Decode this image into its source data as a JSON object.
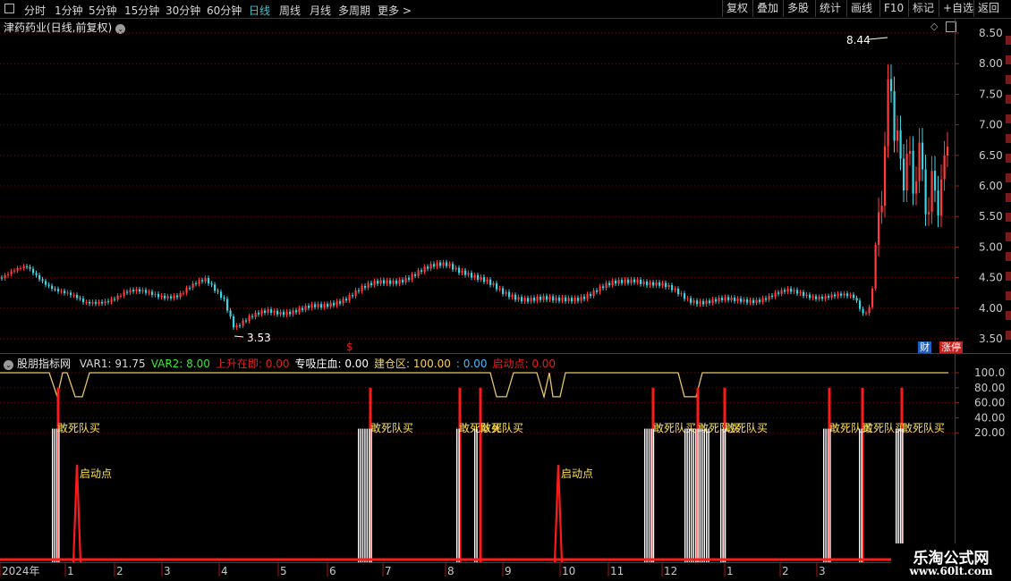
{
  "toolbar": {
    "periods": [
      "分时",
      "1分钟",
      "5分钟",
      "15分钟",
      "30分钟",
      "60分钟",
      "日线",
      "周线",
      "月线",
      "多周期",
      "更多"
    ],
    "active_period": "日线",
    "more_arrow": ">",
    "buttons": [
      "复权",
      "叠加",
      "多股",
      "统计",
      "画线",
      "F10",
      "标记",
      "+自选",
      "返回"
    ]
  },
  "main_chart": {
    "title": "津药药业(日线,前复权)",
    "price_ticks": [
      "8.50",
      "8.00",
      "7.50",
      "7.00",
      "6.50",
      "6.00",
      "5.50",
      "5.00",
      "4.50",
      "4.00",
      "3.50"
    ],
    "high_label": "8.44",
    "low_label": "3.53",
    "badges": [
      "财",
      "涨停"
    ],
    "colors": {
      "up": "#ff3b3b",
      "down": "#3fd2e2",
      "flat": "#ffffff",
      "grid": "#8b0000"
    }
  },
  "indicator": {
    "name": "股朋指标网",
    "values": [
      {
        "label": "VAR1: 91.75",
        "color": "#d8d8d8"
      },
      {
        "label": "VAR2: 8.00",
        "color": "#39e639"
      },
      {
        "label": "上升在即: 0.00",
        "color": "#e02020"
      },
      {
        "label": "专吸庄血: 0.00",
        "color": "#ffffff"
      },
      {
        "label": "建仓区: 100.00",
        "color": "#ffd24a"
      },
      {
        "label": ": 0.00",
        "color": "#4ab8ff"
      },
      {
        "label": "启动点: 0.00",
        "color": "#e02020"
      }
    ],
    "y_ticks": [
      "100.0",
      "80.00",
      "60.00",
      "40.00",
      "20.00"
    ],
    "buy_label": "敢死队买",
    "start_label": "启动点",
    "colors": {
      "line": "#e8c66a",
      "red": "#ff1a1a",
      "white": "#ffffff",
      "text_yellow": "#ffe04a"
    }
  },
  "date_axis": {
    "labels": [
      "2024年",
      "1",
      "2",
      "3",
      "4",
      "5",
      "6",
      "7",
      "8",
      "9",
      "10",
      "11",
      "12",
      "1",
      "2",
      "3"
    ]
  },
  "watermark": {
    "line1": "乐淘公式网",
    "line2": "www.60lt.com"
  }
}
